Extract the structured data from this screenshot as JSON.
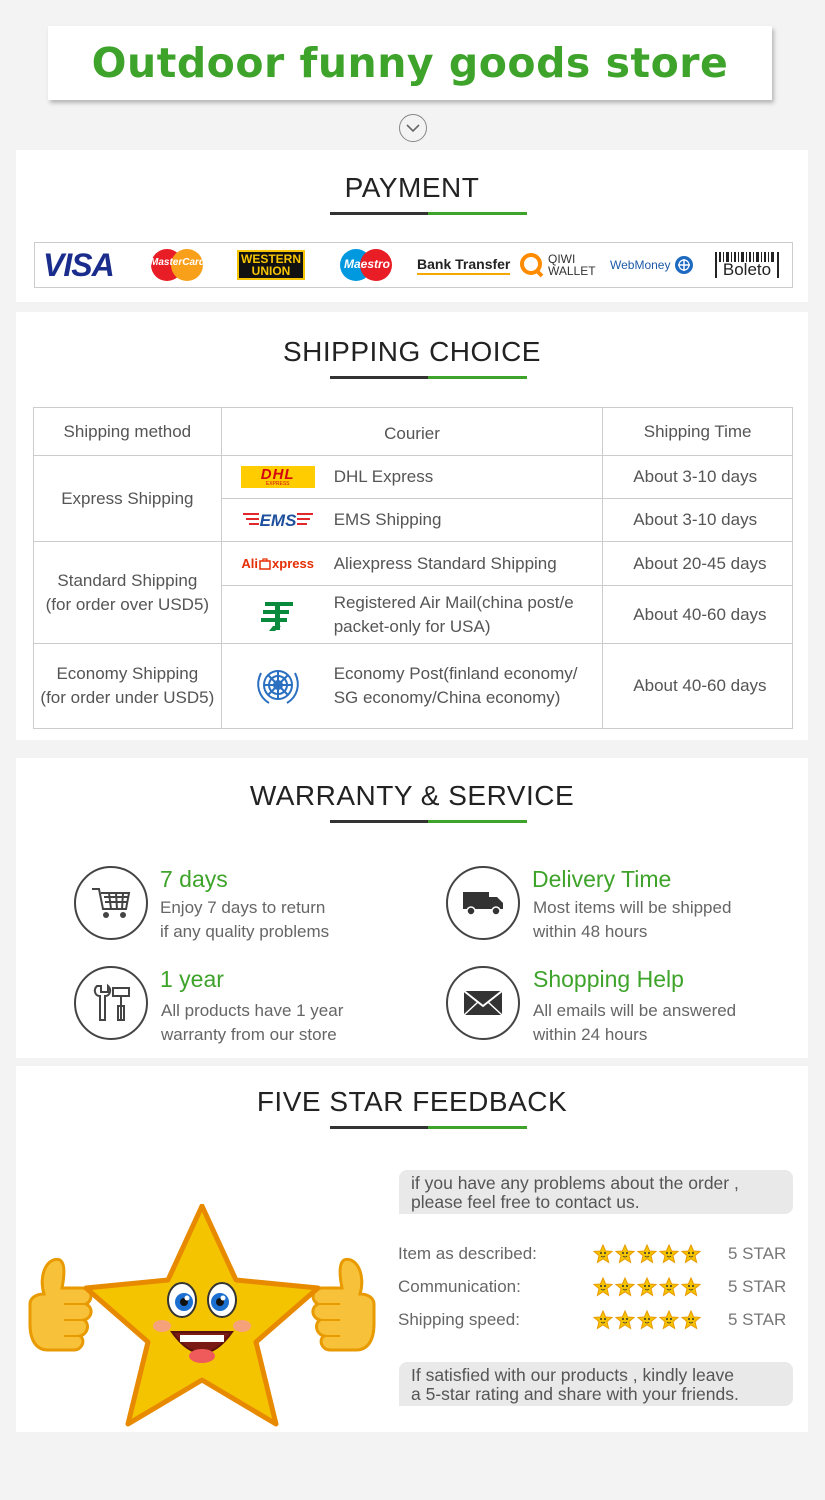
{
  "banner": {
    "title": "Outdoor funny goods store",
    "chevron_icon": "chevron-down-icon"
  },
  "payment": {
    "title": "PAYMENT",
    "logos": {
      "visa": "VISA",
      "mastercard": "MasterCard",
      "western_union_1": "WESTERN",
      "western_union_2": "UNION",
      "maestro": "Maestro",
      "bank_transfer": "Bank Transfer",
      "qiwi_1": "QIWI",
      "qiwi_2": "WALLET",
      "webmoney": "WebMoney",
      "boleto": "Boleto"
    }
  },
  "shipping": {
    "title": "SHIPPING CHOICE",
    "headers": {
      "method": "Shipping method",
      "courier": "Courier",
      "time": "Shipping Time"
    },
    "groups": [
      {
        "method_line1": "Express Shipping",
        "method_line2": ""
      },
      {
        "method_line1": "Standard Shipping",
        "method_line2": "(for order over USD5)"
      },
      {
        "method_line1": "Economy Shipping",
        "method_line2": "(for order under USD5)"
      }
    ],
    "rows": [
      {
        "courier": "DHL Express",
        "time": "About 3-10 days",
        "icon": "dhl-logo-icon"
      },
      {
        "courier": "EMS Shipping",
        "time": "About 3-10 days",
        "icon": "ems-logo-icon"
      },
      {
        "courier": "Aliexpress Standard Shipping",
        "time": "About 20-45 days",
        "icon": "aliexpress-logo-icon"
      },
      {
        "courier_line1": "Registered Air Mail(china post/e",
        "courier_line2": "packet-only for USA)",
        "time": "About 40-60 days",
        "icon": "china-post-logo-icon"
      },
      {
        "courier_line1": "Economy Post(finland economy/",
        "courier_line2": "SG economy/China economy)",
        "time": "About 40-60 days",
        "icon": "un-logo-icon"
      }
    ],
    "logo_text": {
      "dhl": "DHL",
      "dhl_sub": "EXPRESS",
      "ems": "EMS",
      "ali_1": "Ali",
      "ali_2": "xpress"
    }
  },
  "warranty": {
    "title": "WARRANTY & SERVICE",
    "items": [
      {
        "head": "7 days",
        "line1": "Enjoy 7 days to return",
        "line2": "if any quality problems",
        "icon": "shopping-cart-icon"
      },
      {
        "head": "Delivery Time",
        "line1": "Most items will be shipped",
        "line2": "within 48 hours",
        "icon": "truck-icon"
      },
      {
        "head": "1 year",
        "line1": "All products have 1 year",
        "line2": "warranty from our store",
        "icon": "tools-icon"
      },
      {
        "head": "Shopping Help",
        "line1": "All emails will be answered",
        "line2": "within 24 hours",
        "icon": "envelope-icon"
      }
    ]
  },
  "feedback": {
    "title": "FIVE STAR FEEDBACK",
    "bubble_top_1": "if you have any problems about the order ,",
    "bubble_top_2": "please feel free to contact us.",
    "ratings": [
      {
        "label": "Item as described:",
        "stars": 5,
        "value": "5 STAR"
      },
      {
        "label": "Communication:",
        "stars": 5,
        "value": "5 STAR"
      },
      {
        "label": "Shipping speed:",
        "stars": 5,
        "value": "5 STAR"
      }
    ],
    "bubble_bottom_1": "If satisfied with our products , kindly leave",
    "bubble_bottom_2": "a 5-star rating and share with your friends.",
    "mascot": "smiling-star-mascot-icon",
    "colors": {
      "star": "#f5c400",
      "star_outline": "#e89a00",
      "thumb": "#f7c23a"
    }
  },
  "colors": {
    "accent_green": "#3ea32a",
    "dark": "#333333",
    "border": "#cccccc"
  }
}
